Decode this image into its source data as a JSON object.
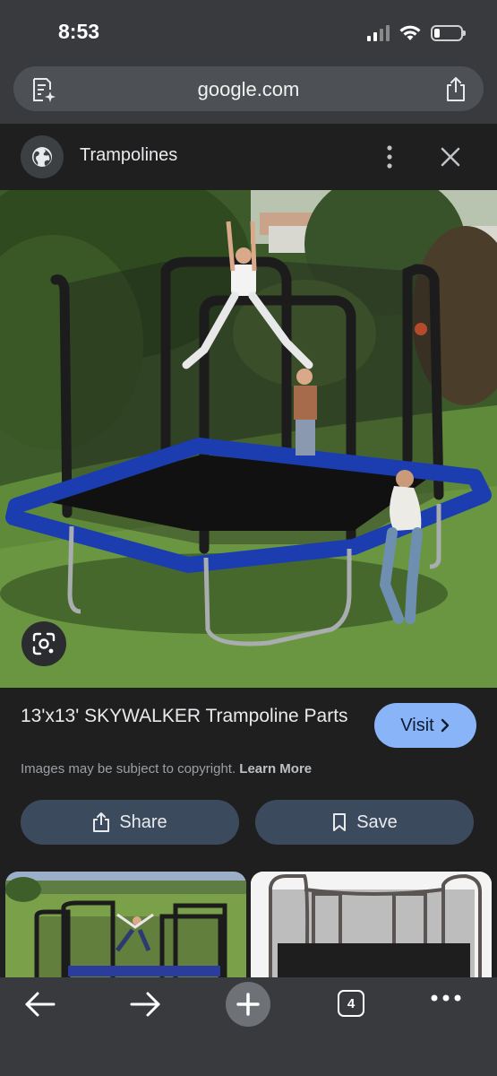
{
  "status_bar": {
    "time": "8:53"
  },
  "browser": {
    "url": "google.com"
  },
  "header": {
    "title": "Trampolines"
  },
  "result": {
    "title": "13'x13' SKYWALKER Trampoline Parts",
    "visit_label": "Visit",
    "copyright_text": "Images may be subject to copyright.",
    "learn_more": "Learn More",
    "share_label": "Share",
    "save_label": "Save"
  },
  "tabs": {
    "count": "4"
  },
  "icons": {
    "page": "page-summary-icon",
    "share": "share-icon",
    "globe": "globe-icon",
    "more": "more-vert-icon",
    "close": "close-icon",
    "lens": "lens-icon",
    "back": "arrow-left-icon",
    "forward": "arrow-right-icon",
    "new_tab": "plus-icon",
    "tabs": "tab-switcher-icon",
    "menu": "more-horiz-icon"
  },
  "colors": {
    "accent": "#8ab4f8",
    "pill": "#3c4a5e",
    "chrome": "#383a3e",
    "background": "#1f1f1f"
  }
}
